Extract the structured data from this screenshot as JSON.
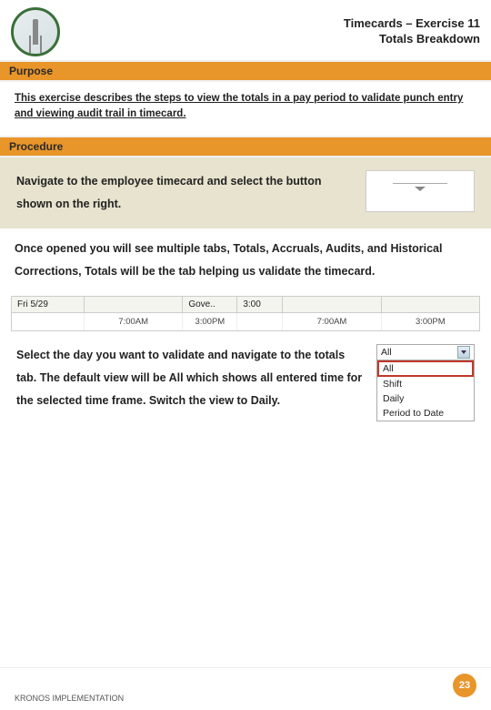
{
  "header": {
    "title_line1": "Timecards – Exercise 11",
    "title_line2": "Totals Breakdown"
  },
  "sections": {
    "purpose_label": "Purpose",
    "procedure_label": "Procedure"
  },
  "intro_text": "This exercise describes the steps to view the totals in a pay period to validate punch entry and viewing audit trail in timecard.",
  "step1_text": "Navigate to the employee timecard and select the button shown on the right.",
  "expand_icon": "expand-drawer",
  "step2_text": "Once opened you will see multiple tabs, Totals, Accruals, Audits, and Historical Corrections, Totals will be the tab helping us validate the timecard.",
  "timecard": {
    "header": {
      "date": "Fri 5/29",
      "mid": "Gove..",
      "val": "3:00"
    },
    "row": {
      "c1": "7:00AM",
      "c2": "3:00PM",
      "c3": "",
      "c4": "",
      "c5": "7:00AM",
      "c6": "3:00PM"
    }
  },
  "step3": {
    "text": "Select the day you want to validate and navigate to the totals tab. The default view will be All which shows all entered time for the selected time frame. Switch the view to Daily.",
    "dropdown_value": "All",
    "options": [
      "All",
      "Shift",
      "Daily",
      "Period to Date"
    ]
  },
  "footer": {
    "label": "KRONOS IMPLEMENTATION",
    "page": "23"
  }
}
